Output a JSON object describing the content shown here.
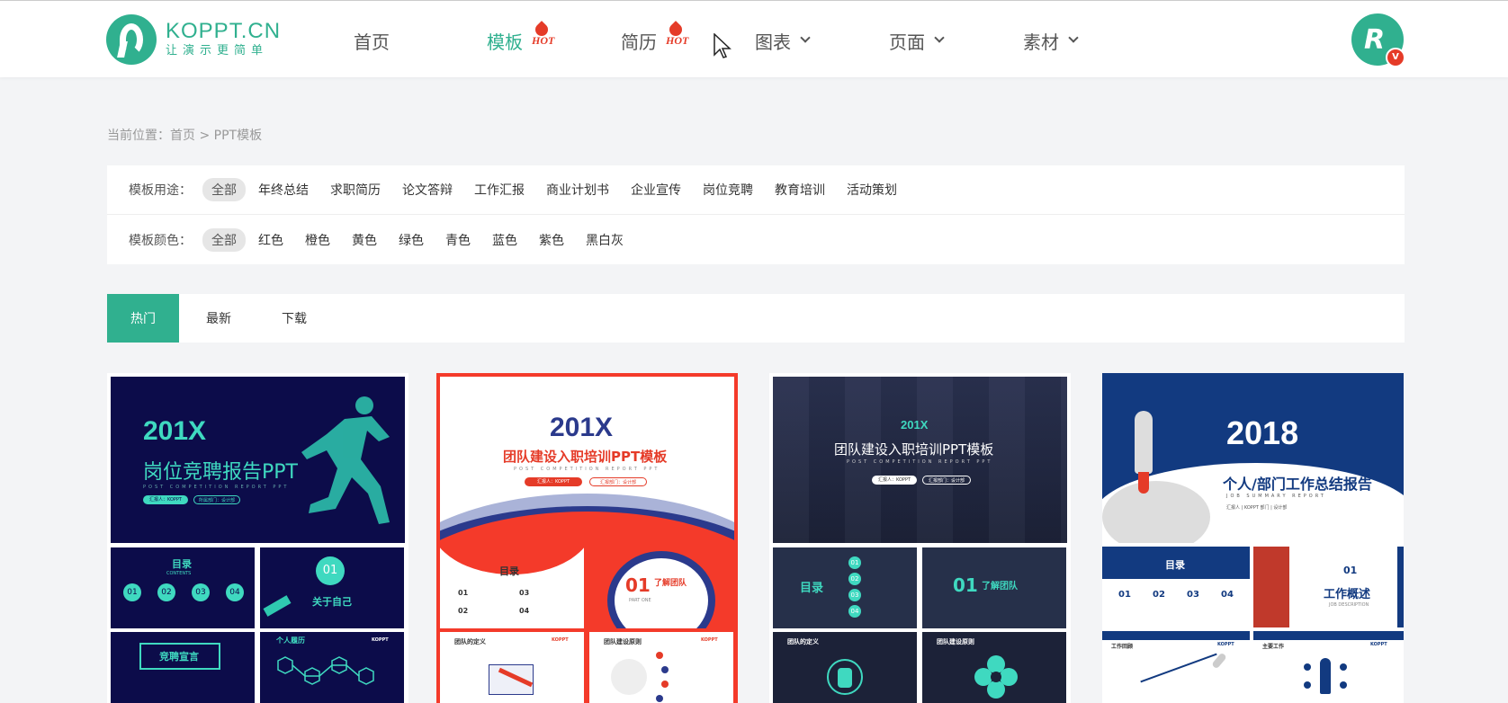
{
  "header": {
    "logo": {
      "title": "KOPPT.CN",
      "slogan": "让演示更简单",
      "icon": "koppt-logo-icon"
    },
    "nav": [
      {
        "label": "首页",
        "active": false,
        "hot": false,
        "dropdown": false
      },
      {
        "label": "模板",
        "active": true,
        "hot": true,
        "dropdown": false
      },
      {
        "label": "简历",
        "active": false,
        "hot": true,
        "dropdown": false
      },
      {
        "label": "图表",
        "active": false,
        "hot": false,
        "dropdown": true
      },
      {
        "label": "页面",
        "active": false,
        "hot": false,
        "dropdown": true
      },
      {
        "label": "素材",
        "active": false,
        "hot": false,
        "dropdown": true
      }
    ],
    "hot_label": "HOT",
    "avatar": {
      "letter": "R",
      "badge": "V"
    }
  },
  "breadcrumb": "当前位置：首页 > PPT模板",
  "filters": {
    "usage": {
      "label": "模板用途：",
      "options": [
        "全部",
        "年终总结",
        "求职简历",
        "论文答辩",
        "工作汇报",
        "商业计划书",
        "企业宣传",
        "岗位竞聘",
        "教育培训",
        "活动策划"
      ],
      "selected": "全部"
    },
    "color": {
      "label": "模板颜色：",
      "options": [
        "全部",
        "红色",
        "橙色",
        "黄色",
        "绿色",
        "青色",
        "蓝色",
        "紫色",
        "黑白灰"
      ],
      "selected": "全部"
    }
  },
  "tabs": [
    {
      "label": "热门",
      "active": true
    },
    {
      "label": "最新",
      "active": false
    },
    {
      "label": "下载",
      "active": false
    }
  ],
  "cards": [
    {
      "year": "201X",
      "title": "岗位竞聘报告PPT",
      "subtitle": "POST COMPETITION REPORT PPT",
      "pills": [
        "汇报人：KOPPT",
        "所属部门：设计部"
      ],
      "toc": "目录",
      "toc_sub": "CONTENTS",
      "nums": [
        "01",
        "02",
        "03",
        "04"
      ],
      "about": "关于自己",
      "section": "01",
      "speech": "竞聘宣言",
      "history": "个人履历",
      "brand": "KOPPT"
    },
    {
      "year": "201X",
      "title": "团队建设入职培训PPT模板",
      "subtitle": "POST COMPETITION REPORT PPT",
      "pills": [
        "汇报人：KOPPT",
        "汇报部门：设计部"
      ],
      "toc": "目录",
      "toc_items": [
        "01",
        "02",
        "03",
        "04"
      ],
      "section": "01",
      "section_title": "了解团队",
      "section_sub": "PART ONE",
      "p3_title": "团队的定义",
      "p4_title": "团队建设原则",
      "brand": "KOPPT"
    },
    {
      "year": "201X",
      "title": "团队建设入职培训PPT模板",
      "subtitle": "POST COMPETITION REPORT PPT",
      "pills": [
        "汇报人：KOPPT",
        "汇报部门：设计部"
      ],
      "toc": "目录",
      "nums": [
        "01",
        "02",
        "03",
        "04"
      ],
      "section": "01",
      "section_title": "了解团队",
      "p3_title": "团队的定义",
      "p4_title": "团队建设原则"
    },
    {
      "year": "2018",
      "title": "个人/部门工作总结报告",
      "subtitle": "JOB SUMMARY REPORT",
      "meta": "汇报人 | KOPPT    部门 | 设计部",
      "toc": "目录",
      "nums": [
        "01",
        "02",
        "03",
        "04"
      ],
      "section": "01",
      "section_title": "工作概述",
      "section_sub": "JOB DESCRIPTION",
      "p3_title": "工作回顾",
      "p4_title": "主要工作",
      "brand": "KOPPT"
    }
  ],
  "colors": {
    "brand": "#30b08f",
    "hot": "#e53b28"
  }
}
